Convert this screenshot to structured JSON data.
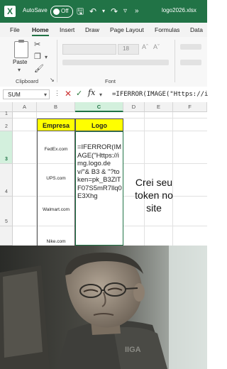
{
  "titlebar": {
    "autosave_label": "AutoSave",
    "autosave_state": "Off",
    "filename": "logo2026.xlsx",
    "icons": [
      "excel-logo-icon",
      "save-icon",
      "undo-icon",
      "redo-icon",
      "filter-icon"
    ]
  },
  "menu": {
    "tabs": [
      "File",
      "Home",
      "Insert",
      "Draw",
      "Page Layout",
      "Formulas",
      "Data"
    ],
    "active": "Home"
  },
  "ribbon": {
    "paste_label": "Paste",
    "clipboard_label": "Clipboard",
    "font_group_label": "Font",
    "font_size": "18"
  },
  "formula_bar": {
    "name_box": "SUM",
    "formula": "=IFERROR(IMAGE(\"Https://i"
  },
  "grid": {
    "columns": [
      "A",
      "B",
      "C",
      "D",
      "E",
      "F"
    ],
    "rows": [
      "1",
      "2",
      "3",
      "4",
      "5"
    ],
    "headers": {
      "empresa": "Empresa",
      "logo": "Logo"
    },
    "companies": [
      "FedEx.com",
      "UPS.com",
      "Walmart.com",
      "Nike.com"
    ],
    "logo_formula": "=IFERROR(IMAGE(\"Https://img.logo.dev/\"& B3 & \"?token=pk_B3ZlTF07S5mR7llq0E3Xhg"
  },
  "meme_caption": "Crei seu token no site",
  "colors": {
    "excel_green": "#217346",
    "header_yellow": "#ffff00"
  }
}
